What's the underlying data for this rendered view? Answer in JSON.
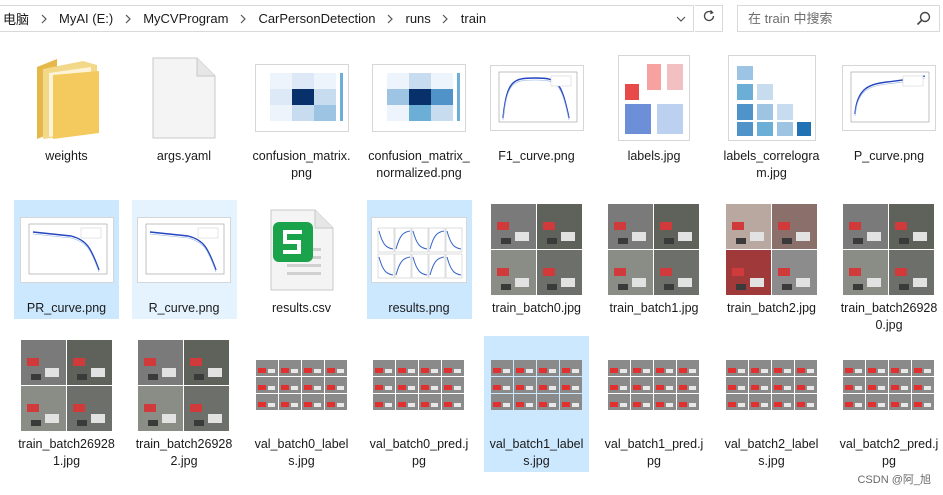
{
  "address_bar": {
    "crumbs": [
      "电脑",
      "MyAI (E:)",
      "MyCVProgram",
      "CarPersonDetection",
      "runs",
      "train"
    ]
  },
  "search": {
    "placeholder": "在 train 中搜索"
  },
  "files": [
    {
      "name": "weights",
      "kind": "folder"
    },
    {
      "name": "args.yaml",
      "kind": "doc"
    },
    {
      "name": "confusion_matrix.png",
      "kind": "confusion"
    },
    {
      "name": "confusion_matrix_normalized.png",
      "kind": "confusion-norm"
    },
    {
      "name": "F1_curve.png",
      "kind": "curve"
    },
    {
      "name": "labels.jpg",
      "kind": "labels"
    },
    {
      "name": "labels_correlogram.jpg",
      "kind": "correlogram"
    },
    {
      "name": "P_curve.png",
      "kind": "curve-up"
    },
    {
      "name": "PR_curve.png",
      "kind": "curve-down",
      "state": "selected"
    },
    {
      "name": "R_curve.png",
      "kind": "curve-down",
      "state": "hover"
    },
    {
      "name": "results.csv",
      "kind": "csv"
    },
    {
      "name": "results.png",
      "kind": "results",
      "state": "selected"
    },
    {
      "name": "train_batch0.jpg",
      "kind": "mosaic"
    },
    {
      "name": "train_batch1.jpg",
      "kind": "mosaic"
    },
    {
      "name": "train_batch2.jpg",
      "kind": "mosaic-red"
    },
    {
      "name": "train_batch269280.jpg",
      "kind": "mosaic"
    },
    {
      "name": "train_batch269281.jpg",
      "kind": "mosaic"
    },
    {
      "name": "train_batch269282.jpg",
      "kind": "mosaic"
    },
    {
      "name": "val_batch0_labels.jpg",
      "kind": "val"
    },
    {
      "name": "val_batch0_pred.jpg",
      "kind": "val"
    },
    {
      "name": "val_batch1_labels.jpg",
      "kind": "val",
      "state": "selected"
    },
    {
      "name": "val_batch1_pred.jpg",
      "kind": "val"
    },
    {
      "name": "val_batch2_labels.jpg",
      "kind": "val"
    },
    {
      "name": "val_batch2_pred.jpg",
      "kind": "val"
    }
  ],
  "colors": {
    "selected": "#cce8ff",
    "hover": "#e5f3ff",
    "folder": "#f4c95d",
    "csv": "#1aa34a"
  },
  "watermark": "CSDN @阿_旭"
}
